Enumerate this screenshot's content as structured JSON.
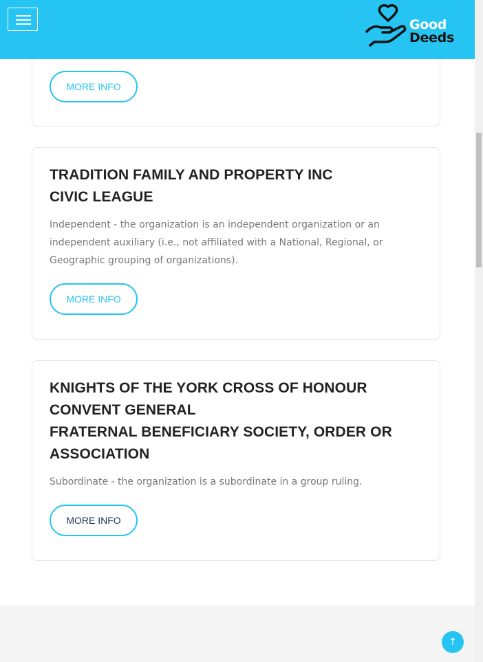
{
  "header": {
    "brand_line1": "Good",
    "brand_line2": "Deeds",
    "accent_color": "#25c4f2"
  },
  "cards": [
    {
      "title_lines": [],
      "description": "",
      "button_label": "MORE INFO"
    },
    {
      "title_lines": [
        "TRADITION FAMILY AND PROPERTY INC",
        "CIVIC LEAGUE"
      ],
      "description": "Independent - the organization is an independent organization or an independent auxiliary (i.e., not affiliated with a National, Regional, or Geographic grouping of organizations).",
      "button_label": "MORE INFO"
    },
    {
      "title_lines": [
        "KNIGHTS OF THE YORK CROSS OF HONOUR",
        "CONVENT GENERAL",
        "FRATERNAL BENEFICIARY SOCIETY, ORDER OR",
        "ASSOCIATION"
      ],
      "description": "Subordinate - the organization is a subordinate in a group ruling.",
      "button_label": "MORE INFO"
    }
  ],
  "back_to_top_icon": "arrow-up-icon"
}
